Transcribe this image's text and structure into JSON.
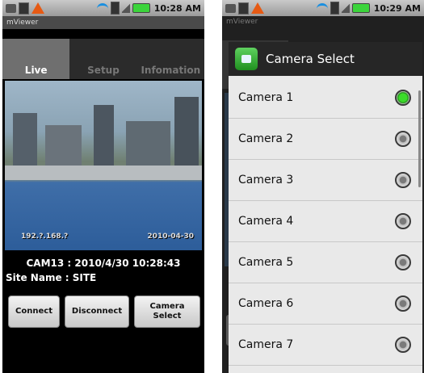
{
  "left": {
    "status": {
      "time": "10:28 AM"
    },
    "app_title": "mViewer",
    "tabs": [
      {
        "label": "Live"
      },
      {
        "label": "Setup"
      },
      {
        "label": "Infomation"
      }
    ],
    "video_overlay": {
      "left_text": "192.?.168.? ",
      "right_text": "2010-04-30"
    },
    "camera_info": "CAM13 : 2010/4/30 10:28:43",
    "site_name": "Site Name : SITE",
    "buttons": {
      "connect": "Connect",
      "disconnect": "Disconnect",
      "camera_select": "Camera\nSelect"
    }
  },
  "right": {
    "status": {
      "time": "10:29 AM"
    },
    "app_title": "mViewer",
    "dialog": {
      "title": "Camera Select",
      "cameras": [
        {
          "label": "Camera 1",
          "selected": true
        },
        {
          "label": "Camera 2",
          "selected": false
        },
        {
          "label": "Camera 3",
          "selected": false
        },
        {
          "label": "Camera 4",
          "selected": false
        },
        {
          "label": "Camera 5",
          "selected": false
        },
        {
          "label": "Camera 6",
          "selected": false
        },
        {
          "label": "Camera 7",
          "selected": false
        }
      ]
    }
  },
  "colors": {
    "battery": "#3bd43b",
    "warning": "#e65a14",
    "radio_selected": "#3bdc2a"
  }
}
